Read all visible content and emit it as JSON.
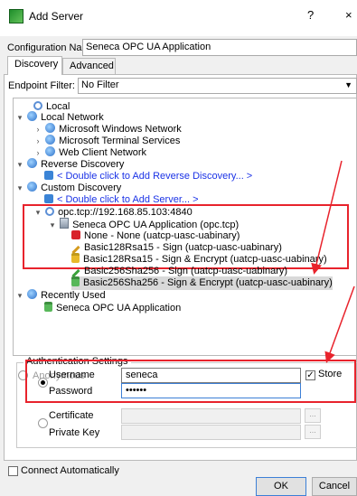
{
  "window": {
    "title": "Add Server",
    "help": "?",
    "close": "×"
  },
  "config": {
    "label": "Configuration Name",
    "value": "Seneca OPC UA Application"
  },
  "tabs": [
    {
      "label": "Discovery"
    },
    {
      "label": "Advanced"
    }
  ],
  "endpoint_filter": {
    "label": "Endpoint Filter:",
    "value": "No Filter",
    "arrow": "▼"
  },
  "tree": {
    "local": "Local",
    "local_network": "Local Network",
    "ms_windows_network": "Microsoft Windows Network",
    "ms_terminal_services": "Microsoft Terminal Services",
    "web_client_network": "Web Client Network",
    "reverse_discovery": "Reverse Discovery",
    "add_reverse": "< Double click to Add Reverse Discovery... >",
    "custom_discovery": "Custom Discovery",
    "add_server": "< Double click to Add Server... >",
    "opc_url": "opc.tcp://192.168.85.103:4840",
    "app": "Seneca OPC UA Application (opc.tcp)",
    "ep1": "None - None (uatcp-uasc-uabinary)",
    "ep2": "Basic128Rsa15 - Sign (uatcp-uasc-uabinary)",
    "ep3": "Basic128Rsa15 - Sign & Encrypt (uatcp-uasc-uabinary)",
    "ep4": "Basic256Sha256 - Sign (uatcp-uasc-uabinary)",
    "ep5": "Basic256Sha256 - Sign & Encrypt (uatcp-uasc-uabinary)",
    "recently_used": "Recently Used",
    "recent_app": "Seneca OPC UA Application"
  },
  "auth": {
    "legend": "Authentication Settings",
    "anonymous": "Anonymous",
    "username_label": "Username",
    "username_value": "seneca",
    "store_label": "Store",
    "password_label": "Password",
    "password_value": "••••••",
    "certificate_label": "Certificate",
    "private_key_label": "Private Key",
    "browse": "..."
  },
  "connect_automatically": "Connect Automatically",
  "buttons": {
    "ok": "OK",
    "cancel": "Cancel"
  },
  "colors": {
    "link": "#1a32e6",
    "highlight_box": "#e8232c",
    "arrow": "#e8232c"
  }
}
